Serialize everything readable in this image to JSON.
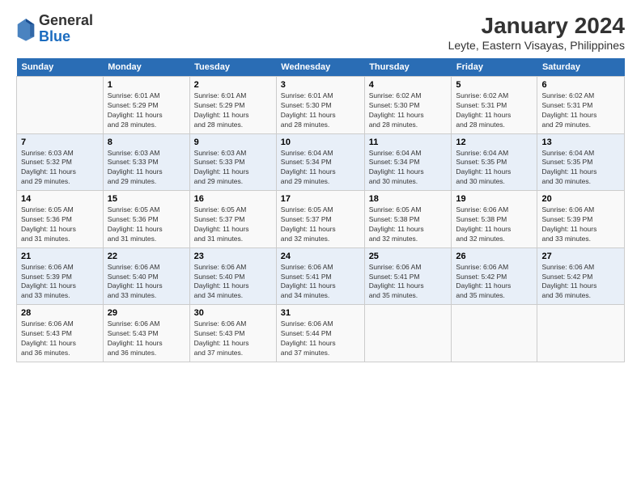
{
  "logo": {
    "general": "General",
    "blue": "Blue"
  },
  "title": "January 2024",
  "subtitle": "Leyte, Eastern Visayas, Philippines",
  "days_of_week": [
    "Sunday",
    "Monday",
    "Tuesday",
    "Wednesday",
    "Thursday",
    "Friday",
    "Saturday"
  ],
  "weeks": [
    [
      {
        "day": "",
        "info": ""
      },
      {
        "day": "1",
        "info": "Sunrise: 6:01 AM\nSunset: 5:29 PM\nDaylight: 11 hours\nand 28 minutes."
      },
      {
        "day": "2",
        "info": "Sunrise: 6:01 AM\nSunset: 5:29 PM\nDaylight: 11 hours\nand 28 minutes."
      },
      {
        "day": "3",
        "info": "Sunrise: 6:01 AM\nSunset: 5:30 PM\nDaylight: 11 hours\nand 28 minutes."
      },
      {
        "day": "4",
        "info": "Sunrise: 6:02 AM\nSunset: 5:30 PM\nDaylight: 11 hours\nand 28 minutes."
      },
      {
        "day": "5",
        "info": "Sunrise: 6:02 AM\nSunset: 5:31 PM\nDaylight: 11 hours\nand 28 minutes."
      },
      {
        "day": "6",
        "info": "Sunrise: 6:02 AM\nSunset: 5:31 PM\nDaylight: 11 hours\nand 29 minutes."
      }
    ],
    [
      {
        "day": "7",
        "info": "Sunrise: 6:03 AM\nSunset: 5:32 PM\nDaylight: 11 hours\nand 29 minutes."
      },
      {
        "day": "8",
        "info": "Sunrise: 6:03 AM\nSunset: 5:33 PM\nDaylight: 11 hours\nand 29 minutes."
      },
      {
        "day": "9",
        "info": "Sunrise: 6:03 AM\nSunset: 5:33 PM\nDaylight: 11 hours\nand 29 minutes."
      },
      {
        "day": "10",
        "info": "Sunrise: 6:04 AM\nSunset: 5:34 PM\nDaylight: 11 hours\nand 29 minutes."
      },
      {
        "day": "11",
        "info": "Sunrise: 6:04 AM\nSunset: 5:34 PM\nDaylight: 11 hours\nand 30 minutes."
      },
      {
        "day": "12",
        "info": "Sunrise: 6:04 AM\nSunset: 5:35 PM\nDaylight: 11 hours\nand 30 minutes."
      },
      {
        "day": "13",
        "info": "Sunrise: 6:04 AM\nSunset: 5:35 PM\nDaylight: 11 hours\nand 30 minutes."
      }
    ],
    [
      {
        "day": "14",
        "info": "Sunrise: 6:05 AM\nSunset: 5:36 PM\nDaylight: 11 hours\nand 31 minutes."
      },
      {
        "day": "15",
        "info": "Sunrise: 6:05 AM\nSunset: 5:36 PM\nDaylight: 11 hours\nand 31 minutes."
      },
      {
        "day": "16",
        "info": "Sunrise: 6:05 AM\nSunset: 5:37 PM\nDaylight: 11 hours\nand 31 minutes."
      },
      {
        "day": "17",
        "info": "Sunrise: 6:05 AM\nSunset: 5:37 PM\nDaylight: 11 hours\nand 32 minutes."
      },
      {
        "day": "18",
        "info": "Sunrise: 6:05 AM\nSunset: 5:38 PM\nDaylight: 11 hours\nand 32 minutes."
      },
      {
        "day": "19",
        "info": "Sunrise: 6:06 AM\nSunset: 5:38 PM\nDaylight: 11 hours\nand 32 minutes."
      },
      {
        "day": "20",
        "info": "Sunrise: 6:06 AM\nSunset: 5:39 PM\nDaylight: 11 hours\nand 33 minutes."
      }
    ],
    [
      {
        "day": "21",
        "info": "Sunrise: 6:06 AM\nSunset: 5:39 PM\nDaylight: 11 hours\nand 33 minutes."
      },
      {
        "day": "22",
        "info": "Sunrise: 6:06 AM\nSunset: 5:40 PM\nDaylight: 11 hours\nand 33 minutes."
      },
      {
        "day": "23",
        "info": "Sunrise: 6:06 AM\nSunset: 5:40 PM\nDaylight: 11 hours\nand 34 minutes."
      },
      {
        "day": "24",
        "info": "Sunrise: 6:06 AM\nSunset: 5:41 PM\nDaylight: 11 hours\nand 34 minutes."
      },
      {
        "day": "25",
        "info": "Sunrise: 6:06 AM\nSunset: 5:41 PM\nDaylight: 11 hours\nand 35 minutes."
      },
      {
        "day": "26",
        "info": "Sunrise: 6:06 AM\nSunset: 5:42 PM\nDaylight: 11 hours\nand 35 minutes."
      },
      {
        "day": "27",
        "info": "Sunrise: 6:06 AM\nSunset: 5:42 PM\nDaylight: 11 hours\nand 36 minutes."
      }
    ],
    [
      {
        "day": "28",
        "info": "Sunrise: 6:06 AM\nSunset: 5:43 PM\nDaylight: 11 hours\nand 36 minutes."
      },
      {
        "day": "29",
        "info": "Sunrise: 6:06 AM\nSunset: 5:43 PM\nDaylight: 11 hours\nand 36 minutes."
      },
      {
        "day": "30",
        "info": "Sunrise: 6:06 AM\nSunset: 5:43 PM\nDaylight: 11 hours\nand 37 minutes."
      },
      {
        "day": "31",
        "info": "Sunrise: 6:06 AM\nSunset: 5:44 PM\nDaylight: 11 hours\nand 37 minutes."
      },
      {
        "day": "",
        "info": ""
      },
      {
        "day": "",
        "info": ""
      },
      {
        "day": "",
        "info": ""
      }
    ]
  ]
}
